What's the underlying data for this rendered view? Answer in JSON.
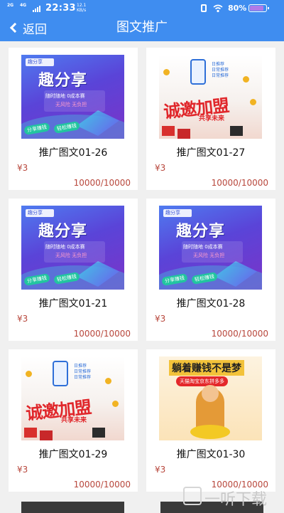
{
  "status_bar": {
    "net1": "2G",
    "net2": "4G",
    "time": "22:33",
    "speed_value": "12.1",
    "speed_unit": "KB/s",
    "battery": "80%"
  },
  "nav": {
    "back_label": "返回",
    "title": "图文推广"
  },
  "thumbnails": {
    "qfx": {
      "logo": "趣分享",
      "headline": "趣分享",
      "line1": "随时随地 0成本赛",
      "line2": "无风险 无负担",
      "pill1": "分享赚钱",
      "pill2": "轻松赚钱"
    },
    "cxh": {
      "tags": [
        "日推荐",
        "日常推荐",
        "日常推荐"
      ],
      "headline": "诚邀加盟",
      "sub": "共享未来"
    },
    "ka": {
      "headline": "躺着赚钱不是梦",
      "sub": "天猫淘宝京东拼多多"
    }
  },
  "items": [
    {
      "name": "推广图文01-26",
      "price": "¥3",
      "stock": "10000/10000",
      "art": "qfx"
    },
    {
      "name": "推广图文01-27",
      "price": "¥3",
      "stock": "10000/10000",
      "art": "cxh"
    },
    {
      "name": "推广图文01-21",
      "price": "¥3",
      "stock": "10000/10000",
      "art": "qfx"
    },
    {
      "name": "推广图文01-28",
      "price": "¥3",
      "stock": "10000/10000",
      "art": "qfx"
    },
    {
      "name": "推广图文01-29",
      "price": "¥3",
      "stock": "10000/10000",
      "art": "cxh"
    },
    {
      "name": "推广图文01-30",
      "price": "¥3",
      "stock": "10000/10000",
      "art": "ka"
    }
  ],
  "watermark": "一听下载",
  "colors": {
    "brand_blue": "#3f8df0",
    "price_red": "#b8473c"
  }
}
